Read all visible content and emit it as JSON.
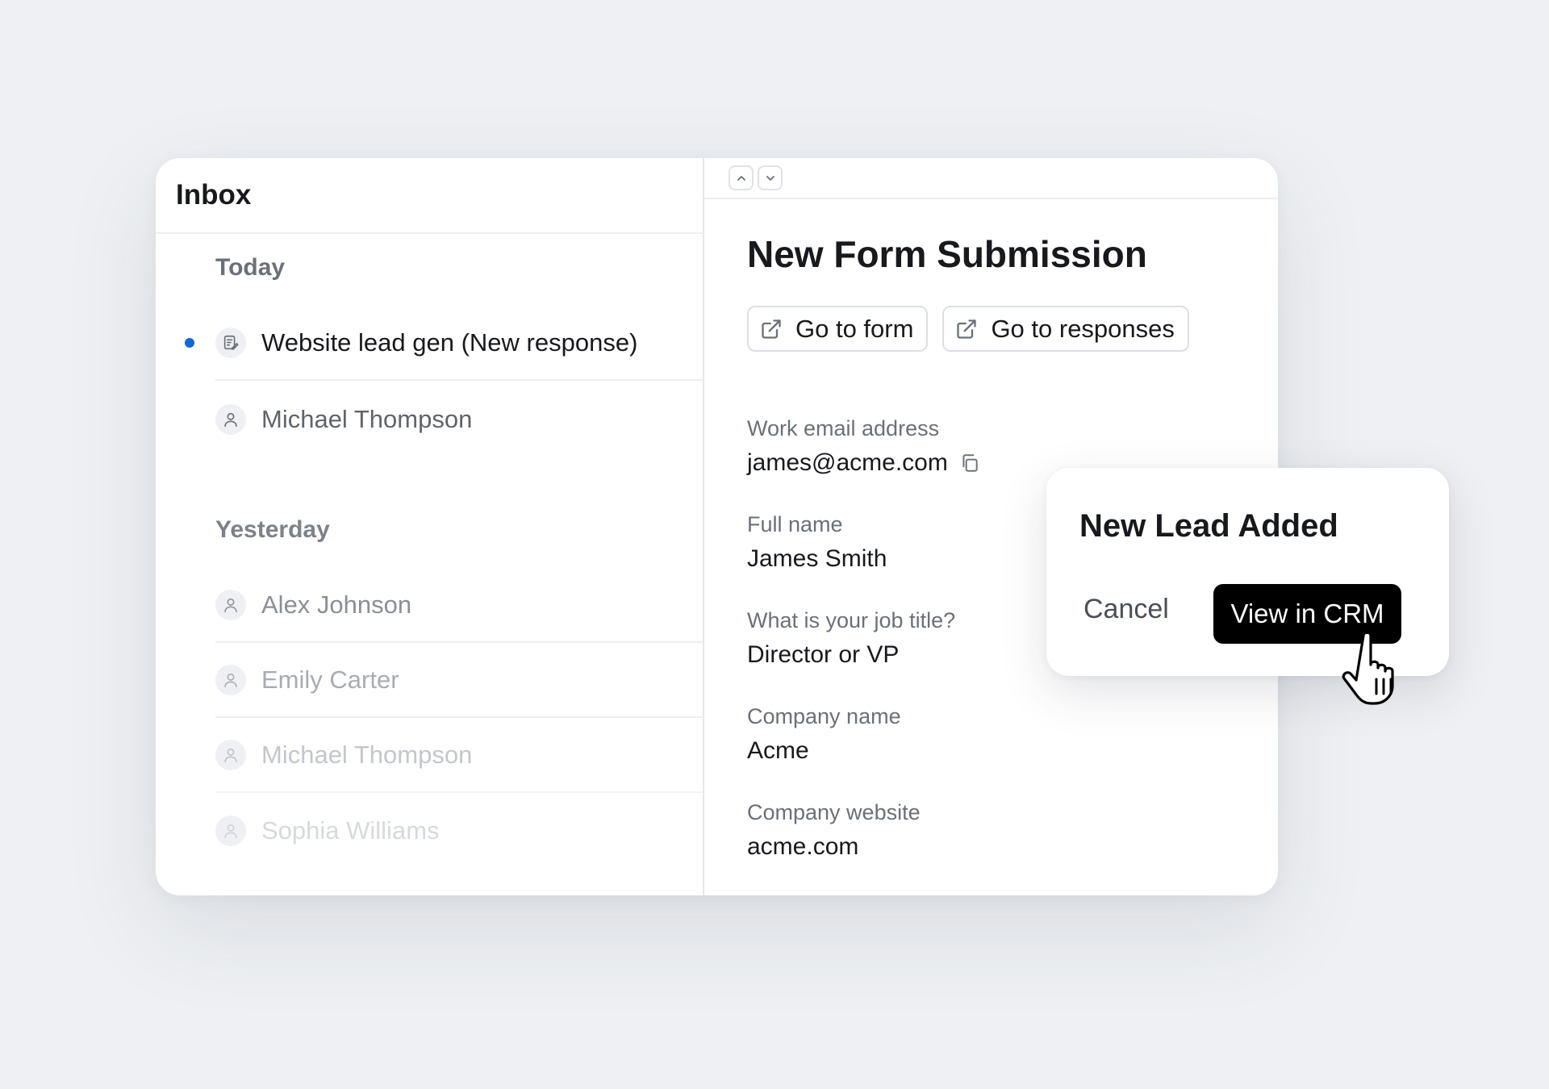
{
  "inbox": {
    "title": "Inbox",
    "sections": [
      {
        "label": "Today",
        "items": [
          {
            "label": "Website lead gen (New response)",
            "icon": "form-icon",
            "unread": true
          },
          {
            "label": "Michael Thompson",
            "icon": "user-icon"
          }
        ]
      },
      {
        "label": "Yesterday",
        "items": [
          {
            "label": "Alex Johnson",
            "icon": "user-icon"
          },
          {
            "label": "Emily Carter",
            "icon": "user-icon"
          },
          {
            "label": "Michael Thompson",
            "icon": "user-icon"
          },
          {
            "label": "Sophia Williams",
            "icon": "user-icon"
          }
        ]
      }
    ]
  },
  "detail": {
    "title": "New Form Submission",
    "actions": [
      {
        "label": "Go to form",
        "icon": "external-link-icon"
      },
      {
        "label": "Go to responses",
        "icon": "external-link-icon"
      }
    ],
    "fields": [
      {
        "label": "Work email address",
        "value": "james@acme.com",
        "copyable": true
      },
      {
        "label": "Full name",
        "value": "James Smith"
      },
      {
        "label": "What is your job title?",
        "value": "Director or VP"
      },
      {
        "label": "Company name",
        "value": "Acme"
      },
      {
        "label": "Company website",
        "value": "acme.com"
      }
    ]
  },
  "toast": {
    "title": "New Lead Added",
    "cancel_label": "Cancel",
    "primary_label": "View in CRM"
  },
  "colors": {
    "accent_dot": "#1366d6",
    "primary_button": "#000000",
    "background": "#eef0f3"
  }
}
